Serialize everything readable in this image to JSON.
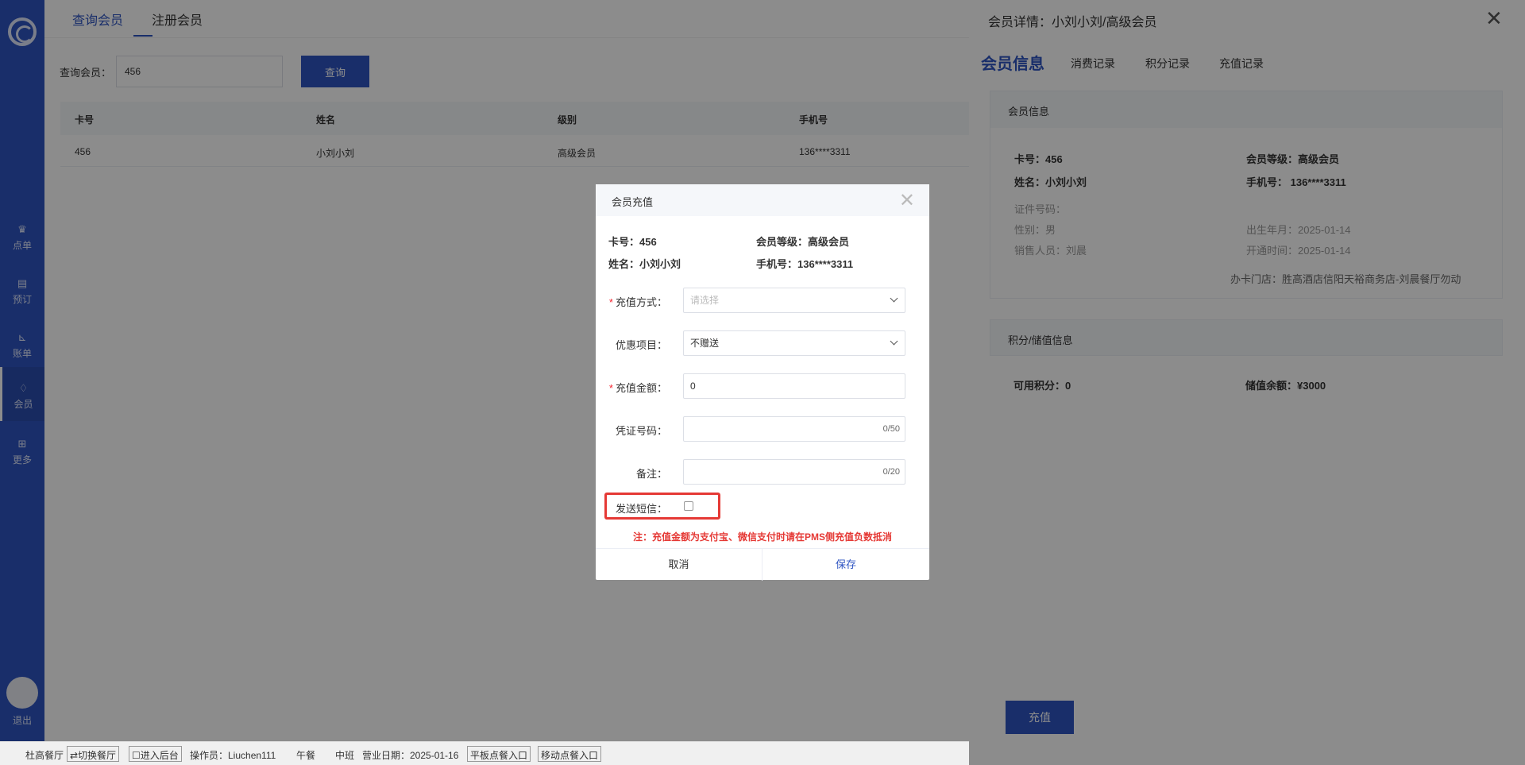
{
  "sidebar": {
    "items": [
      {
        "label": "点单",
        "icon": "crown-icon"
      },
      {
        "label": "预订",
        "icon": "book-icon"
      },
      {
        "label": "账单",
        "icon": "chart-icon"
      },
      {
        "label": "会员",
        "icon": "diamond-icon"
      },
      {
        "label": "更多",
        "icon": "grid-icon"
      }
    ],
    "logout": "退出"
  },
  "top_tabs": [
    "查询会员",
    "注册会员"
  ],
  "search": {
    "label": "查询会员：",
    "value": "456",
    "button": "查询"
  },
  "table": {
    "headers": [
      "卡号",
      "姓名",
      "级别",
      "手机号"
    ],
    "rows": [
      [
        "456",
        "小刘小刘",
        "高级会员",
        "136****3311"
      ]
    ]
  },
  "drawer": {
    "title": "会员详情：小刘小刘/高级会员",
    "tabs": [
      "会员信息",
      "消费记录",
      "积分记录",
      "充值记录"
    ],
    "member_card": {
      "header": "会员信息",
      "card_no": "卡号：456",
      "level": "会员等级：高级会员",
      "name": "姓名：小刘小刘",
      "phone": "手机号： 136****3311",
      "id_no": "证件号码：",
      "gender": "性别：男",
      "birth": "出生年月：2025-01-14",
      "sales": "销售人员：刘晨",
      "open_time": "开通时间：2025-01-14",
      "store": "办卡门店：胜高酒店信阳天裕商务店-刘晨餐厅勿动"
    },
    "points_card": {
      "header": "积分/储值信息",
      "points": "可用积分：0",
      "balance": "储值余额：¥3000"
    },
    "recharge_button": "充值"
  },
  "modal": {
    "title": "会员充值",
    "card_no": "卡号：456",
    "level": "会员等级：高级会员",
    "name": "姓名：小刘小刘",
    "phone": "手机号：136****3311",
    "fields": {
      "method": {
        "label": "充值方式：",
        "placeholder": "请选择"
      },
      "promo": {
        "label": "优惠项目：",
        "value": "不赠送"
      },
      "amount": {
        "label": "充值金额：",
        "value": "0"
      },
      "voucher": {
        "label": "凭证号码：",
        "counter": "0/50"
      },
      "remark": {
        "label": "备注：",
        "counter": "0/20"
      },
      "sms": {
        "label": "发送短信："
      }
    },
    "note": "注：充值金额为支付宝、微信支付时请在PMS侧充值负数抵消",
    "cancel": "取消",
    "save": "保存"
  },
  "statusbar": {
    "restaurant": "杜高餐厅",
    "switch": "⇄切换餐厅",
    "backend": "☐进入后台",
    "operator": "操作员：Liuchen111",
    "meal": "午餐",
    "shift": "中班",
    "business_date": "营业日期：2025-01-16",
    "tablet": "平板点餐入口",
    "mobile": "移动点餐入口"
  },
  "colors": {
    "primary": "#2f55c2",
    "danger": "#e53935"
  }
}
